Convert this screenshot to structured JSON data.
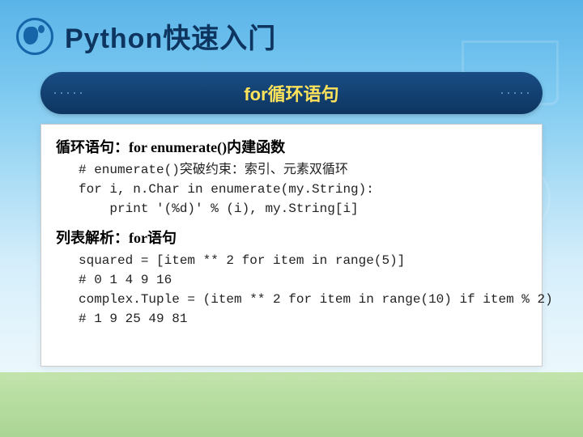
{
  "header": {
    "title": "Python快速入门"
  },
  "banner": {
    "title": "for循环语句"
  },
  "sections": [
    {
      "heading": "循环语句：for enumerate()内建函数",
      "code": "# enumerate()突破约束：索引、元素双循环\nfor i, n.Char in enumerate(my.String):\n    print '(%d)' % (i), my.String[i]"
    },
    {
      "heading": "列表解析：for语句",
      "code": "squared = [item ** 2 for item in range(5)]\n# 0 1 4 9 16\ncomplex.Tuple = (item ** 2 for item in range(10) if item % 2)\n# 1 9 25 49 81"
    }
  ]
}
